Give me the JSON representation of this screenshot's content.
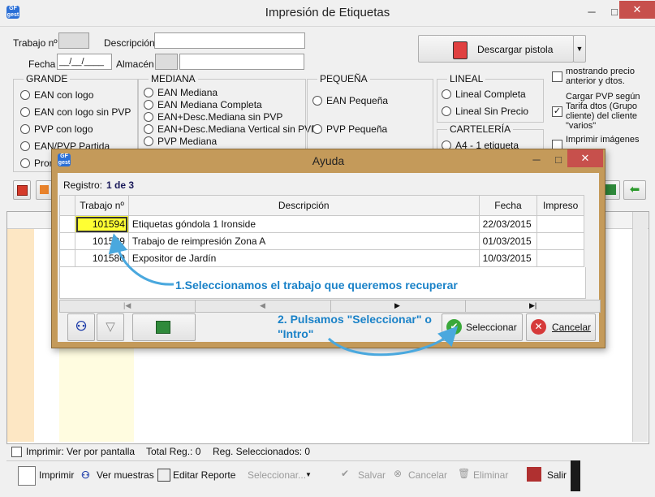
{
  "window": {
    "title": "Impresión de Etiquetas"
  },
  "form": {
    "trabajo_label": "Trabajo nº",
    "descripcion_label": "Descripción",
    "fecha_label": "Fecha",
    "fecha_value": "__/__/____",
    "almacen_label": "Almacén",
    "descargar_label": "Descargar pistola"
  },
  "groups": {
    "grande": {
      "title": "GRANDE",
      "options": [
        "EAN con logo",
        "EAN con logo sin PVP",
        "PVP con logo",
        "EAN/PVP Partida",
        "Prom"
      ]
    },
    "mediana": {
      "title": "MEDIANA",
      "options": [
        "EAN Mediana",
        "EAN Mediana Completa",
        "EAN+Desc.Mediana sin PVP",
        "EAN+Desc.Mediana Vertical sin PVP",
        "PVP Mediana"
      ]
    },
    "pequena": {
      "title": "PEQUEÑA",
      "options": [
        "EAN Pequeña",
        "PVP Pequeña"
      ]
    },
    "lineal": {
      "title": "LINEAL",
      "options": [
        "Lineal Completa",
        "Lineal Sin Precio"
      ]
    },
    "carteleria": {
      "title": "CARTELERÍA",
      "options": [
        "A4 - 1 etiqueta"
      ]
    }
  },
  "right_options": {
    "opt1": "mostrando precio anterior y dtos.",
    "opt2": "Cargar PVP según Tarifa dtos (Grupo cliente) del cliente \"varios\"",
    "opt3": "Imprimir imágenes"
  },
  "status": {
    "imprimir_label": "Imprimir: Ver por pantalla",
    "total_label": "Total Reg.: 0",
    "selec_label": "Reg. Seleccionados: 0"
  },
  "bottom": {
    "imprimir": "Imprimir",
    "ver_muestras": "Ver muestras",
    "editar_reporte": "Editar Reporte",
    "seleccionar": "Seleccionar...",
    "salvar": "Salvar",
    "cancelar": "Cancelar",
    "eliminar": "Eliminar",
    "salir": "Salir"
  },
  "dialog": {
    "title": "Ayuda",
    "registro_label": "Registro:",
    "registro_value": "1 de 3",
    "columns": [
      "Trabajo nº",
      "Descripción",
      "Fecha",
      "Impreso"
    ],
    "rows": [
      {
        "trabajo": "101594",
        "descripcion": "Etiquetas góndola 1 Ironside",
        "fecha": "22/03/2015",
        "impreso": ""
      },
      {
        "trabajo": "101589",
        "descripcion": "Trabajo de reimpresión Zona A",
        "fecha": "01/03/2015",
        "impreso": ""
      },
      {
        "trabajo": "101580",
        "descripcion": "Expositor de Jardín",
        "fecha": "10/03/2015",
        "impreso": ""
      }
    ],
    "seleccionar_label": "Seleccionar",
    "cancelar_label": "Cancelar"
  },
  "annotations": {
    "note1": "1.Seleccionamos el trabajo que queremos recuperar",
    "note2_line1": "2. Pulsamos \"Seleccionar\" o",
    "note2_line2": "\"Intro\""
  },
  "colors": {
    "accent_note": "#1a82c8",
    "dialog_frame": "#c49a5a",
    "selected_cell": "#ffff33"
  }
}
